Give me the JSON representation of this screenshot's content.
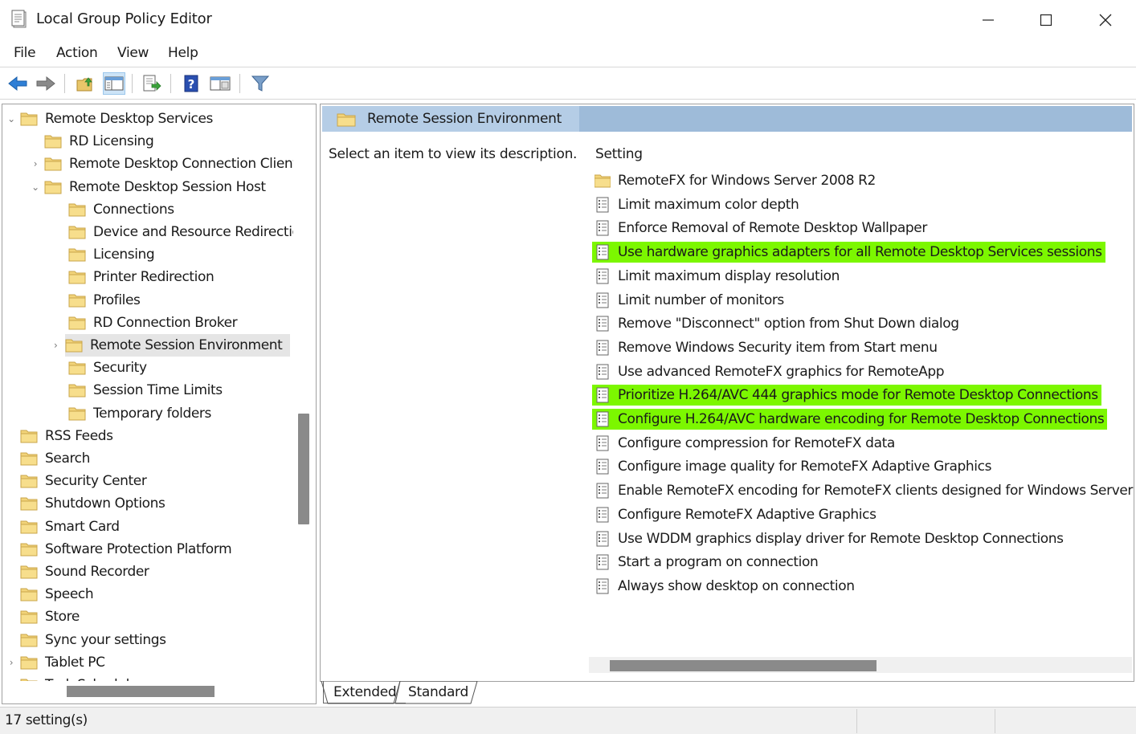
{
  "window": {
    "title": "Local Group Policy Editor"
  },
  "menu": [
    "File",
    "Action",
    "View",
    "Help"
  ],
  "toolbar": {
    "buttons": [
      "back-arrow-icon",
      "forward-arrow-icon",
      "up-folder-icon",
      "show-hide-tree-icon",
      "export-list-icon",
      "help-icon",
      "properties-icon",
      "filter-icon"
    ]
  },
  "tree": {
    "items": [
      {
        "label": "Remote Desktop Services",
        "level": 0,
        "chevron": "⌄"
      },
      {
        "label": "RD Licensing",
        "level": 1,
        "chevron": ""
      },
      {
        "label": "Remote Desktop Connection Client",
        "level": 1,
        "chevron": "›"
      },
      {
        "label": "Remote Desktop Session Host",
        "level": 1,
        "chevron": "⌄"
      },
      {
        "label": "Connections",
        "level": 2,
        "chevron": ""
      },
      {
        "label": "Device and Resource Redirection",
        "level": 2,
        "chevron": ""
      },
      {
        "label": "Licensing",
        "level": 2,
        "chevron": ""
      },
      {
        "label": "Printer Redirection",
        "level": 2,
        "chevron": ""
      },
      {
        "label": "Profiles",
        "level": 2,
        "chevron": ""
      },
      {
        "label": "RD Connection Broker",
        "level": 2,
        "chevron": ""
      },
      {
        "label": "Remote Session Environment",
        "level": 2,
        "chevron": "›",
        "selected": true
      },
      {
        "label": "Security",
        "level": 2,
        "chevron": ""
      },
      {
        "label": "Session Time Limits",
        "level": 2,
        "chevron": ""
      },
      {
        "label": "Temporary folders",
        "level": 2,
        "chevron": ""
      },
      {
        "label": "RSS Feeds",
        "level": 0,
        "chevron": ""
      },
      {
        "label": "Search",
        "level": 0,
        "chevron": ""
      },
      {
        "label": "Security Center",
        "level": 0,
        "chevron": ""
      },
      {
        "label": "Shutdown Options",
        "level": 0,
        "chevron": ""
      },
      {
        "label": "Smart Card",
        "level": 0,
        "chevron": ""
      },
      {
        "label": "Software Protection Platform",
        "level": 0,
        "chevron": ""
      },
      {
        "label": "Sound Recorder",
        "level": 0,
        "chevron": ""
      },
      {
        "label": "Speech",
        "level": 0,
        "chevron": ""
      },
      {
        "label": "Store",
        "level": 0,
        "chevron": ""
      },
      {
        "label": "Sync your settings",
        "level": 0,
        "chevron": ""
      },
      {
        "label": "Tablet PC",
        "level": 0,
        "chevron": "›"
      },
      {
        "label": "Task Scheduler",
        "level": 0,
        "chevron": ""
      }
    ]
  },
  "right": {
    "header": "Remote Session Environment",
    "description": "Select an item to view its description.",
    "column_header": "Setting",
    "settings": [
      {
        "label": "RemoteFX for Windows Server 2008 R2",
        "icon": "folder-icon",
        "highlighted": false
      },
      {
        "label": "Limit maximum color depth",
        "icon": "policy-setting-icon",
        "highlighted": false
      },
      {
        "label": "Enforce Removal of Remote Desktop Wallpaper",
        "icon": "policy-setting-icon",
        "highlighted": false
      },
      {
        "label": "Use hardware graphics adapters for all Remote Desktop Services sessions",
        "icon": "policy-setting-icon",
        "highlighted": true
      },
      {
        "label": "Limit maximum display resolution",
        "icon": "policy-setting-icon",
        "highlighted": false
      },
      {
        "label": "Limit number of monitors",
        "icon": "policy-setting-icon",
        "highlighted": false
      },
      {
        "label": "Remove \"Disconnect\" option from Shut Down dialog",
        "icon": "policy-setting-icon",
        "highlighted": false
      },
      {
        "label": "Remove Windows Security item from Start menu",
        "icon": "policy-setting-icon",
        "highlighted": false
      },
      {
        "label": "Use advanced RemoteFX graphics for RemoteApp",
        "icon": "policy-setting-icon",
        "highlighted": false
      },
      {
        "label": "Prioritize H.264/AVC 444 graphics mode for Remote Desktop Connections",
        "icon": "policy-setting-icon",
        "highlighted": true
      },
      {
        "label": "Configure H.264/AVC hardware encoding for Remote Desktop Connections",
        "icon": "policy-setting-icon",
        "highlighted": true
      },
      {
        "label": "Configure compression for RemoteFX data",
        "icon": "policy-setting-icon",
        "highlighted": false
      },
      {
        "label": "Configure image quality for RemoteFX Adaptive Graphics",
        "icon": "policy-setting-icon",
        "highlighted": false
      },
      {
        "label": "Enable RemoteFX encoding for RemoteFX clients designed for Windows Server",
        "icon": "policy-setting-icon",
        "highlighted": false
      },
      {
        "label": "Configure RemoteFX Adaptive Graphics",
        "icon": "policy-setting-icon",
        "highlighted": false
      },
      {
        "label": "Use WDDM graphics display driver for Remote Desktop Connections",
        "icon": "policy-setting-icon",
        "highlighted": false
      },
      {
        "label": "Start a program on connection",
        "icon": "policy-setting-icon",
        "highlighted": false
      },
      {
        "label": "Always show desktop on connection",
        "icon": "policy-setting-icon",
        "highlighted": false
      }
    ]
  },
  "tabs": [
    "Extended",
    "Standard"
  ],
  "status": "17 setting(s)",
  "colors": {
    "highlight": "#7cf700",
    "header_bar": "#9ebbd9",
    "selection": "#e5e5e5"
  }
}
